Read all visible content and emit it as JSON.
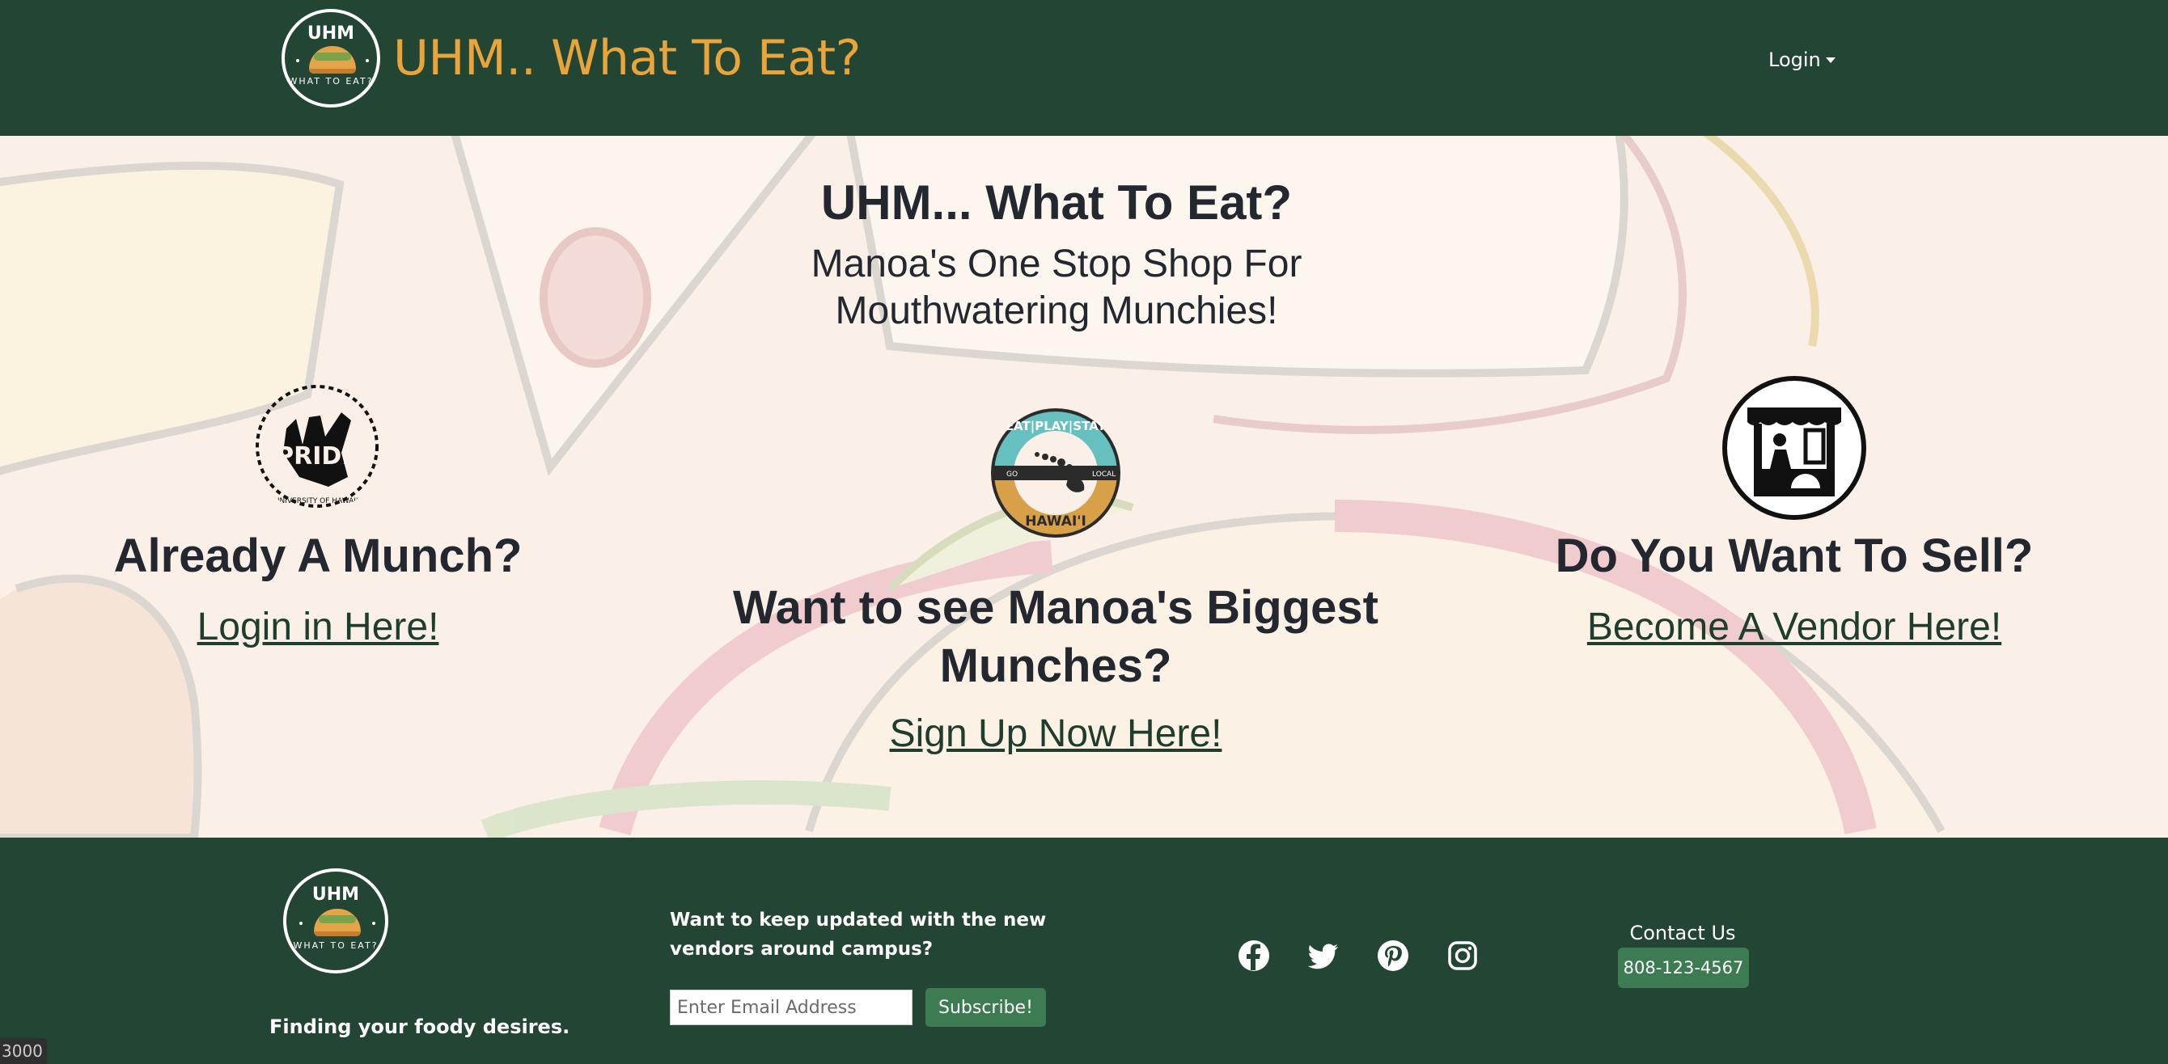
{
  "navbar": {
    "logo_text": "UHM",
    "logo_sub": "WHAT TO EAT?",
    "brand_title": "UHM.. What To Eat?",
    "login_label": "Login"
  },
  "hero": {
    "title": "UHM... What To Eat?",
    "subtitle": "Manoa's One Stop Shop For Mouthwatering Munchies!",
    "left": {
      "title": "Already A Munch?",
      "link": "Login in Here!",
      "badge_icon": "uh-pride-shaka-icon"
    },
    "center": {
      "title": "Want to see Manoa's Biggest Munches?",
      "link": "Sign Up Now Here!",
      "badge_icon": "eat-play-stay-hawaii-icon",
      "badge_top": "EAT|PLAY|STAY",
      "badge_bottom": "HAWAI'I",
      "badge_left": "GO",
      "badge_right": "LOCAL"
    },
    "right": {
      "title": "Do You Want To Sell?",
      "link": "Become A Vendor Here!",
      "badge_icon": "vendor-stand-icon"
    }
  },
  "footer": {
    "logo_text": "UHM",
    "logo_sub": "WHAT TO EAT?",
    "tagline": "Finding your foody desires.",
    "updates_text": "Want to keep updated with the new vendors around campus?",
    "email_placeholder": "Enter Email Address",
    "subscribe_label": "Subscribe!",
    "social": [
      "facebook-icon",
      "twitter-icon",
      "pinterest-icon",
      "instagram-icon"
    ],
    "contact_label": "Contact Us",
    "phone": "808-123-4567"
  },
  "dev_port": "3000",
  "colors": {
    "navbar": "#234534",
    "brand": "#e9a43a",
    "hero_bg": "#fbf0e7",
    "button": "#3d7b52"
  }
}
